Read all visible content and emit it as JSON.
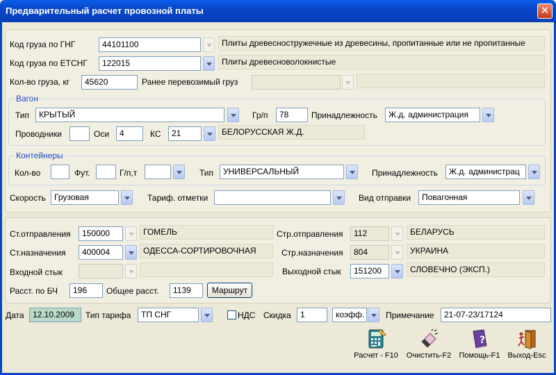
{
  "window": {
    "title": "Предварительный расчет провозной платы",
    "close": "✕"
  },
  "cargo": {
    "gng_label": "Код груза по ГНГ",
    "gng_code": "44101100",
    "gng_desc": "Плиты древесностружечные из древесины, пропитанные или не пропитанные",
    "etsng_label": "Код груза по ЕТСНГ",
    "etsng_code": "122015",
    "etsng_desc": "Плиты древесноволокнистые",
    "qty_label": "Кол-во груза, кг",
    "qty_value": "45620",
    "prev_label": "Ранее перевозимый груз",
    "prev_value": "",
    "prev_desc": ""
  },
  "wagon": {
    "group_title": "Вагон",
    "type_label": "Тип",
    "type_value": "КРЫТЫЙ",
    "gp_label": "Гр/п",
    "gp_value": "78",
    "owner_label": "Принадлежность",
    "owner_value": "Ж.д. администрация",
    "conductors_label": "Проводники",
    "conductors_value": "",
    "axles_label": "Оси",
    "axles_value": "4",
    "ks_label": "КС",
    "ks_value": "21",
    "ks_desc": "БЕЛОРУССКАЯ Ж.Д."
  },
  "containers": {
    "group_title": "Контейнеры",
    "count_label": "Кол-во",
    "count_value": "",
    "ft_label": "Фут.",
    "ft_value": "",
    "gp_label": "Г/п,т",
    "gp_value": "",
    "type_label": "Тип",
    "type_value": "УНИВЕРСАЛЬНЫЙ",
    "owner_label": "Принадлежность",
    "owner_value": "Ж.д. администрац"
  },
  "shipping": {
    "speed_label": "Скорость",
    "speed_value": "Грузовая",
    "tariff_marks_label": "Тариф. отметки",
    "tariff_marks_value": "",
    "dispatch_label": "Вид отправки",
    "dispatch_value": "Повагонная"
  },
  "route": {
    "from_label": "Ст.отправления",
    "from_code": "150000",
    "from_name": "ГОМЕЛЬ",
    "to_label": "Ст.назначения",
    "to_code": "400004",
    "to_name": "ОДЕССА-СОРТИРОВОЧНАЯ",
    "entry_label": "Входной стык",
    "entry_code": "",
    "entry_name": "",
    "from_country_label": "Стр.отправления",
    "from_country_code": "112",
    "from_country_name": "БЕЛАРУСЬ",
    "to_country_label": "Стр.назначения",
    "to_country_code": "804",
    "to_country_name": "УКРАИНА",
    "exit_label": "Выходной стык",
    "exit_code": "151200",
    "exit_name": "СЛОВЕЧНО (ЭКСП.)",
    "bch_label": "Расст. по БЧ",
    "bch_value": "196",
    "total_label": "Общее расст.",
    "total_value": "1139",
    "route_button": "Маршрут"
  },
  "bottom": {
    "date_label": "Дата",
    "date_value": "12.10.2009",
    "tariff_type_label": "Тип тарифа",
    "tariff_type_value": "ТП СНГ",
    "vat_label": "НДС",
    "discount_label": "Скидка",
    "discount_value": "1",
    "discount_unit": "коэфф.",
    "note_label": "Примечание",
    "note_value": "21-07-23/17124"
  },
  "toolbar": {
    "calc": "Расчет - F10",
    "calc_icon": "calculator-icon",
    "clear": "Очистить-F2",
    "clear_icon": "eraser-icon",
    "help": "Помощь-F1",
    "help_icon": "help-book-icon",
    "exit": "Выход-Esc",
    "exit_icon": "exit-door-icon"
  },
  "colors": {
    "title_bar": "#0646c0",
    "group_title": "#1f49c6",
    "date_bg": "#b9dac9",
    "window_bg": "#ece9d8"
  }
}
